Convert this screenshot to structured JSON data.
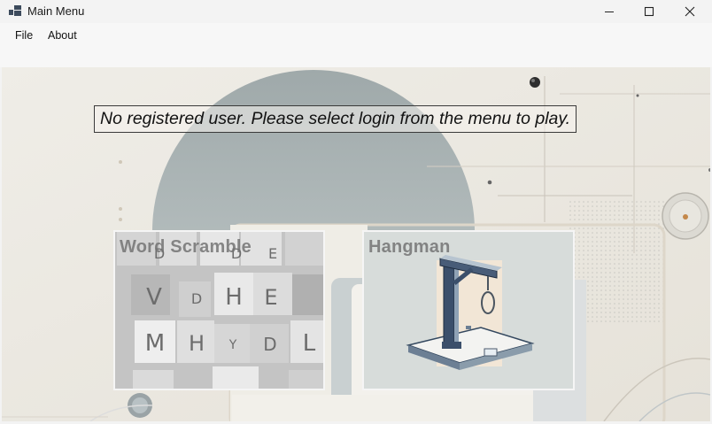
{
  "window": {
    "title": "Main Menu",
    "icons": {
      "app": "app-icon",
      "minimize": "minimize-icon",
      "maximize": "maximize-icon",
      "close": "close-icon"
    }
  },
  "menu": {
    "file_label": "File",
    "about_label": "About"
  },
  "status_message": "No registered user. Please select login from the menu to play.",
  "games": [
    {
      "title": "Word Scramble",
      "tiles": [
        "D",
        "E",
        "V",
        "H",
        "E",
        "M",
        "H",
        "Y",
        "L"
      ]
    },
    {
      "title": "Hangman"
    }
  ]
}
